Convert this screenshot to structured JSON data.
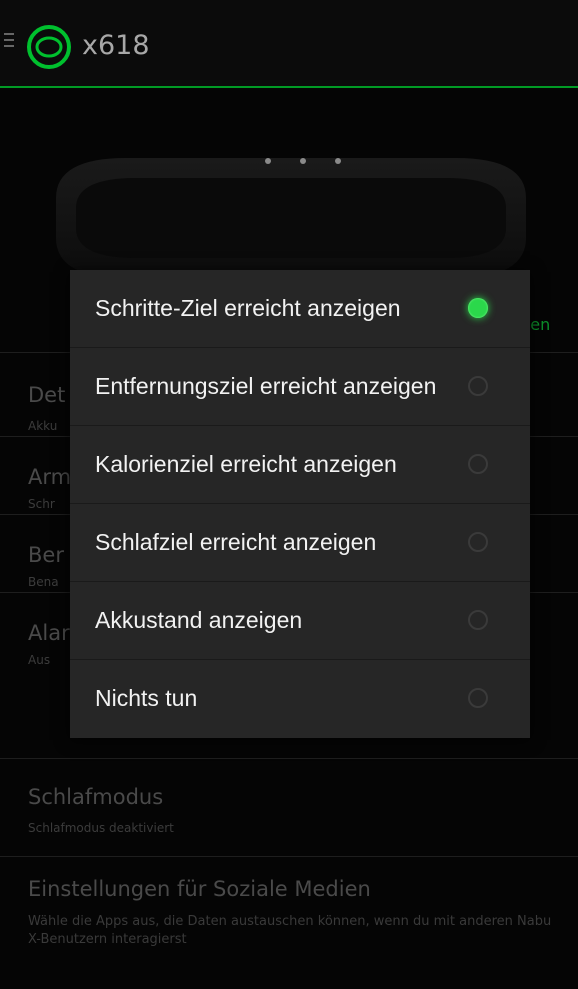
{
  "header": {
    "title": "x618",
    "menu_icon": "hamburger-menu-icon",
    "logo_icon": "nabu-ring-logo-icon",
    "accent_color": "#00b52a"
  },
  "band": {
    "connect_partial": "nden"
  },
  "settings": {
    "items": [
      {
        "title": "Det",
        "subtitle": "Akku"
      },
      {
        "title": "Arm",
        "subtitle": "Schr"
      },
      {
        "title": "Ber",
        "subtitle": "Bena"
      },
      {
        "title": "Alar",
        "subtitle": "Aus"
      },
      {
        "title": "Schlafmodus",
        "subtitle": "Schlafmodus deaktiviert"
      },
      {
        "title": "Einstellungen für Soziale Medien",
        "description": "Wähle die Apps aus, die Daten austauschen können, wenn du mit anderen Nabu X-Benutzern interagierst"
      }
    ]
  },
  "dialog": {
    "options": [
      {
        "label": "Schritte-Ziel erreicht anzeigen",
        "selected": true
      },
      {
        "label": "Entfernungsziel erreicht anzeigen",
        "selected": false
      },
      {
        "label": "Kalorienziel erreicht anzeigen",
        "selected": false
      },
      {
        "label": "Schlafziel erreicht anzeigen",
        "selected": false
      },
      {
        "label": "Akkustand anzeigen",
        "selected": false
      },
      {
        "label": "Nichts tun",
        "selected": false
      }
    ],
    "selected_color": "#2bd84b"
  }
}
